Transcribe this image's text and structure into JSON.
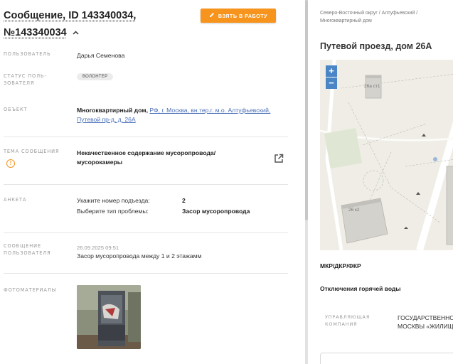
{
  "message": {
    "title_part1": "Сообщение, ID 143340034,",
    "title_part2": "№143340034",
    "take_button": "ВЗЯТЬ В РАБОТУ",
    "fields": {
      "user_label": "ПОЛЬЗОВАТЕЛЬ",
      "user_value": "Дарья Семенова",
      "status_label": "СТАТУС ПОЛЬ-ЗОВАТЕЛЯ",
      "status_value": "ВОЛОНТЕР",
      "object_label": "ОБЪЕКТ",
      "object_value_bold": "Многоквартирный дом,",
      "object_value_link": "РФ, г. Москва, вн.тер.г. м.о. Алтуфьевский, Путевой пр-д, д. 26А",
      "topic_label": "ТЕМА СООБЩЕНИЯ",
      "topic_value": "Некачественное содержание мусоропровода/ мусорокамеры",
      "survey_label": "АНКЕТА",
      "survey_rows": [
        {
          "q": "Укажите номер подъезда:",
          "a": "2"
        },
        {
          "q": "Выберите тип проблемы:",
          "a": "Засор мусоропровода"
        }
      ],
      "msg_label": "СООБЩЕНИЕ ПОЛЬЗОВАТЕЛЯ",
      "msg_date": "26.09.2025 09:51",
      "msg_text": "Засор мусоропровода между 1 и 2 этажамм",
      "photo_label": "ФОТОМАТЕРИАЛЫ"
    }
  },
  "sidebar": {
    "breadcrumb": "Северо-Восточный округ / Алтуфьевский / Многоквартирный дом",
    "title": "Путевой проезд, дом 26А",
    "map": {
      "zoom_in": "+",
      "zoom_out": "−",
      "label_building_1": "26а ст1",
      "label_building_2": "26 к2"
    },
    "mkr": "МКР/ДКР/ФКР",
    "hot_water": "Отключения горячей воды",
    "company_label": "УПРАВЛЯЮЩАЯ КОМПАНИЯ",
    "company_value_line1": "ГОСУДАРСТВЕННОЕ",
    "company_value_line2": "МОСКВЫ «ЖИЛИЩНИ"
  },
  "colors": {
    "accent": "#f7941d",
    "link": "#4a6fb8",
    "map_control": "#4a86c5"
  }
}
